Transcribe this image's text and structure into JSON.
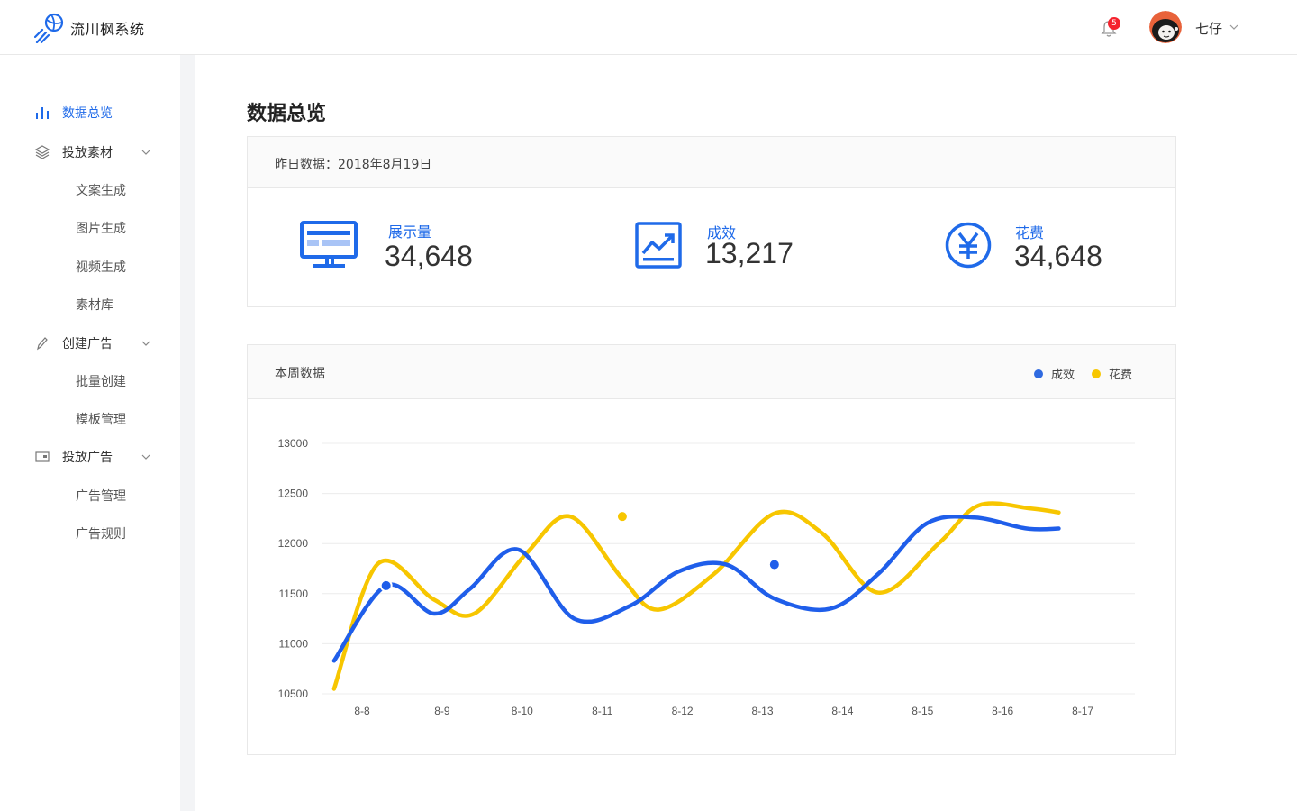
{
  "header": {
    "app_name": "流川枫系统",
    "notification_count": "5",
    "username": "七仔"
  },
  "sidebar": {
    "items": [
      {
        "label": "数据总览",
        "icon": "bar-chart-icon",
        "active": true
      },
      {
        "label": "投放素材",
        "icon": "layers-icon",
        "expandable": true,
        "children": [
          "文案生成",
          "图片生成",
          "视频生成",
          "素材库"
        ]
      },
      {
        "label": "创建广告",
        "icon": "pencil-icon",
        "expandable": true,
        "children": [
          "批量创建",
          "模板管理"
        ]
      },
      {
        "label": "投放广告",
        "icon": "card-icon",
        "expandable": true,
        "children": [
          "广告管理",
          "广告规则"
        ]
      }
    ]
  },
  "main": {
    "title": "数据总览",
    "yesterday": {
      "header": "昨日数据：2018年8月19日",
      "stats": [
        {
          "label": "展示量",
          "value": "34,648",
          "icon": "monitor-icon"
        },
        {
          "label": "成效",
          "value": "13,217",
          "icon": "trend-chart-icon"
        },
        {
          "label": "花费",
          "value": "34,648",
          "icon": "yen-icon"
        }
      ]
    },
    "weekly": {
      "title": "本周数据"
    }
  },
  "colors": {
    "primary": "#1f6ae9",
    "series_effect": "#1f5eea",
    "series_cost": "#f7c600"
  },
  "chart_data": {
    "type": "line",
    "title": "本周数据",
    "categories": [
      "8-8",
      "8-9",
      "8-10",
      "8-11",
      "8-12",
      "8-13",
      "8-14",
      "8-15",
      "8-16",
      "8-17"
    ],
    "ylim": [
      10500,
      13000
    ],
    "yticks": [
      10500,
      11000,
      11500,
      12000,
      12500,
      13000
    ],
    "grid": true,
    "legend": "top-right",
    "series": [
      {
        "name": "成效",
        "color": "#1f5eea",
        "x": [
          7.65,
          8.3,
          8.9,
          9.35,
          9.95,
          10.65,
          11.35,
          11.95,
          12.55,
          13.15,
          13.85,
          14.45,
          15.05,
          15.65,
          16.3,
          16.7
        ],
        "values": [
          10830,
          11580,
          11300,
          11550,
          11940,
          11250,
          11380,
          11720,
          11790,
          11450,
          11350,
          11700,
          12200,
          12260,
          12150,
          12150
        ],
        "markers": [
          {
            "x": 8.3,
            "y": 11580
          },
          {
            "x": 13.15,
            "y": 11790
          }
        ]
      },
      {
        "name": "花费",
        "color": "#f7c600",
        "x": [
          7.65,
          8.2,
          8.9,
          9.4,
          10.05,
          10.6,
          11.25,
          11.7,
          12.4,
          13.15,
          13.75,
          14.45,
          15.2,
          15.7,
          16.35,
          16.7
        ],
        "values": [
          10550,
          11800,
          11440,
          11300,
          11900,
          12270,
          11650,
          11340,
          11700,
          12300,
          12100,
          11510,
          12000,
          12380,
          12350,
          12310
        ],
        "markers": [
          {
            "x": 11.25,
            "y": 12270
          }
        ]
      }
    ]
  }
}
